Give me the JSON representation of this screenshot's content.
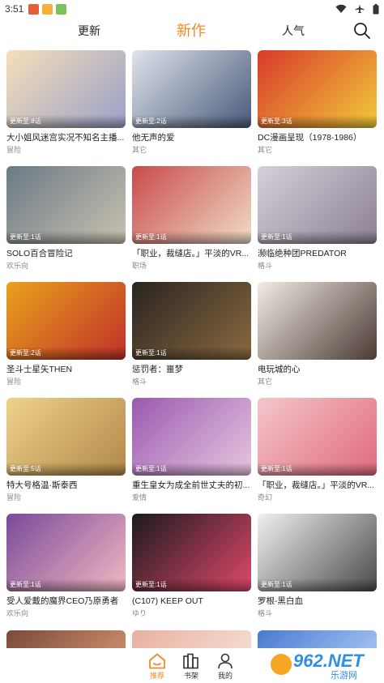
{
  "status_bar": {
    "time": "3:51",
    "app_colors": [
      "#e85c3a",
      "#f3b13c",
      "#7cc25b"
    ]
  },
  "nav": {
    "tabs": [
      {
        "label": "更新",
        "active": false
      },
      {
        "label": "新作",
        "active": true
      },
      {
        "label": "人气",
        "active": false
      }
    ],
    "accent": "#f08a24"
  },
  "cards": [
    {
      "title": "大小姐风迷宫实况不知名主播...",
      "genre": "冒险",
      "badge": "更新至:8话",
      "colors": [
        "#f5dfb8",
        "#9aa0c8"
      ]
    },
    {
      "title": "他无声的爱",
      "genre": "其它",
      "badge": "更新至:2话",
      "colors": [
        "#dfe4ec",
        "#4a5a7a"
      ]
    },
    {
      "title": "DC漫画呈现（1978-1986）",
      "genre": "其它",
      "badge": "更新至:3话",
      "colors": [
        "#d83a2a",
        "#f2c93a"
      ]
    },
    {
      "title": "SOLO百合冒险记",
      "genre": "欢乐向",
      "badge": "更新至:1话",
      "colors": [
        "#6a7a86",
        "#c9c2b0"
      ]
    },
    {
      "title": "「职业，裁缝店。」平淡的VR...",
      "genre": "职场",
      "badge": "更新至:1话",
      "colors": [
        "#c94a4a",
        "#f0dcc8"
      ]
    },
    {
      "title": "濒临绝种团PREDATOR",
      "genre": "格斗",
      "badge": "更新至:1话",
      "colors": [
        "#d6d0d8",
        "#8a8094"
      ]
    },
    {
      "title": "圣斗士星矢THEN",
      "genre": "冒险",
      "badge": "更新至:2话",
      "colors": [
        "#e9a21c",
        "#c0302a"
      ]
    },
    {
      "title": "惩罚者：噩梦",
      "genre": "格斗",
      "badge": "更新至:1话",
      "colors": [
        "#2a2420",
        "#8a6a40"
      ]
    },
    {
      "title": "电玩城的心",
      "genre": "其它",
      "badge": "",
      "colors": [
        "#f2ece4",
        "#4a3a34"
      ]
    },
    {
      "title": "特大号格温·斯泰西",
      "genre": "冒险",
      "badge": "更新至:5话",
      "colors": [
        "#f0d28a",
        "#b08848"
      ]
    },
    {
      "title": "重生皇女为成全前世丈夫的初...",
      "genre": "爱情",
      "badge": "更新至:1话",
      "colors": [
        "#9a5ab0",
        "#e8c6e0"
      ]
    },
    {
      "title": "「职业，裁缝店。」平淡的VR...",
      "genre": "奇幻",
      "badge": "更新至:1话",
      "colors": [
        "#f4c6cc",
        "#e06a7a"
      ]
    },
    {
      "title": "受人爱戴的魔界CEO乃原勇者",
      "genre": "欢乐向",
      "badge": "更新至:1话",
      "colors": [
        "#7a4a9a",
        "#f2b8c2"
      ]
    },
    {
      "title": "(C107) KEEP OUT",
      "genre": "ゆり",
      "badge": "更新至:1话",
      "colors": [
        "#1a1a1e",
        "#e0486a"
      ]
    },
    {
      "title": "罗根-黑白血",
      "genre": "格斗",
      "badge": "更新至:1话",
      "colors": [
        "#f0f0f0",
        "#4a4a4a"
      ]
    }
  ],
  "partial_cards": [
    {
      "colors": [
        "#7a4a3a",
        "#c88a6a"
      ]
    },
    {
      "colors": [
        "#e8b0a0",
        "#f4dcd0"
      ]
    },
    {
      "colors": [
        "#4a7ad0",
        "#a0c0f0"
      ]
    }
  ],
  "bottom_nav": {
    "items": [
      {
        "label": "推荐",
        "active": true
      },
      {
        "label": "书架",
        "active": false
      },
      {
        "label": "我的",
        "active": false
      }
    ]
  },
  "watermark": {
    "brand": "962.NET",
    "sub": "乐游网"
  }
}
